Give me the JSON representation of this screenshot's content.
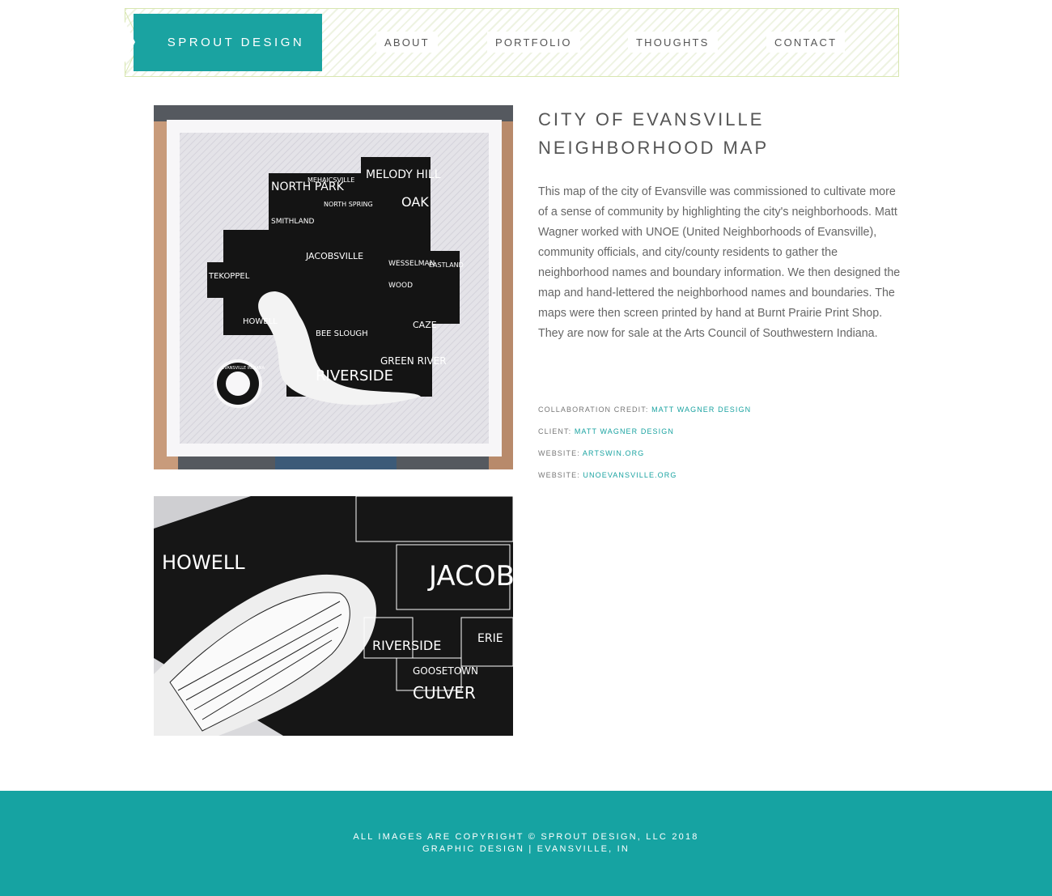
{
  "header": {
    "logo_text": "SPROUT DESIGN",
    "nav": [
      {
        "label": "ABOUT"
      },
      {
        "label": "PORTFOLIO"
      },
      {
        "label": "THOUGHTS"
      },
      {
        "label": "CONTACT"
      }
    ]
  },
  "project": {
    "title_line1": "CITY OF EVANSVILLE",
    "title_line2": "NEIGHBORHOOD MAP",
    "description": "This map of the city of Evansville was commissioned to cultivate more of a sense of community by highlighting the city's neighborhoods. Matt Wagner worked with UNOE (United Neighborhoods of Evansville), community officials, and city/county residents to gather the neighborhood names and boundary information. We then designed the map and hand-lettered the neighborhood names and boundaries. The maps were then screen printed by hand at Burnt Prairie Print Shop. They are now for sale at the Arts Council of Southwestern Indiana.",
    "credits": [
      {
        "label": "COLLABORATION CREDIT:",
        "value": "MATT WAGNER DESIGN"
      },
      {
        "label": "CLIENT:",
        "value": "MATT WAGNER DESIGN"
      },
      {
        "label": "WEBSITE:",
        "value": "ARTSWIN.ORG"
      },
      {
        "label": "WEBSITE:",
        "value": "UNOEVANSVILLE.ORG"
      }
    ]
  },
  "map_labels": {
    "north_park": "NORTH PARK",
    "smithland": "SMITHLAND",
    "mehaicsville": "MEHAICSVILLE",
    "north_spring": "NORTH SPRING",
    "melody": "MELODY HILL",
    "oak": "OAK",
    "jacobsville": "JACOBSVILLE",
    "tekoppel": "TEKOPPEL",
    "howell": "HOWELL",
    "wesselman": "WESSELMAN",
    "eastland": "EASTLAND",
    "riverside": "RIVERSIDE",
    "green_river": "GREEN RIVER",
    "bee_slough": "BEE SLOUGH",
    "wood": "WOOD",
    "caze": "CAZE",
    "seal_text": "EVANSVILLE INDIANA",
    "detail_jacobsville": "JACOBSVILLE",
    "detail_riverside": "RIVERSIDE",
    "detail_culver": "CULVER",
    "detail_erie": "ERIE",
    "detail_goosetown": "GOOSETOWN",
    "detail_howell": "HOWELL"
  },
  "footer": {
    "line1": "ALL IMAGES ARE COPYRIGHT © SPROUT DESIGN, LLC 2018",
    "line2": "GRAPHIC DESIGN | EVANSVILLE, IN"
  },
  "colors": {
    "accent": "#1aa3a1",
    "footer_bg": "#16a3a2",
    "header_border": "#d8e6b0"
  }
}
